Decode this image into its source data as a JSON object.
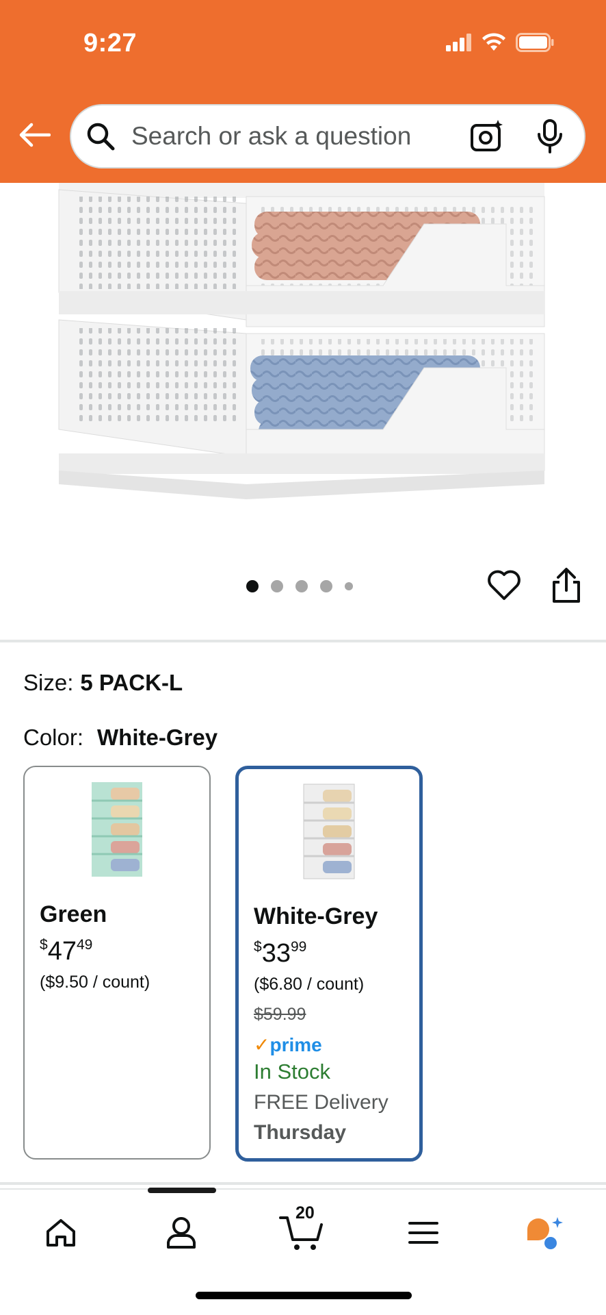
{
  "status_bar": {
    "time": "9:27"
  },
  "search": {
    "placeholder": "Search or ask a question"
  },
  "gallery": {
    "dot_count": 5,
    "active_dot": 1
  },
  "options": {
    "size_label": "Size:",
    "size_value": "5 PACK-L",
    "color_label": "Color:",
    "color_value": "White-Grey"
  },
  "swatches": [
    {
      "name": "Green",
      "price_whole": "47",
      "price_fraction": "49",
      "currency": "$",
      "unit_price": "($9.50 / count)",
      "selected": false
    },
    {
      "name": "White-Grey",
      "price_whole": "33",
      "price_fraction": "99",
      "currency": "$",
      "unit_price": "($6.80 / count)",
      "list_price": "$59.99",
      "prime_check": "✓",
      "prime_label": "prime",
      "availability": "In Stock",
      "delivery": "FREE Delivery",
      "delivery_day": "Thursday",
      "selected": true
    }
  ],
  "bottom_nav": {
    "cart_count": "20",
    "items": [
      "home-icon",
      "account-icon",
      "cart-icon",
      "menu-icon",
      "rufus-icon"
    ]
  },
  "colors": {
    "header": "#ee6e2e",
    "selected_border": "#2f5f9c",
    "in_stock": "#2d7d32",
    "prime": "#1f8ee6"
  }
}
